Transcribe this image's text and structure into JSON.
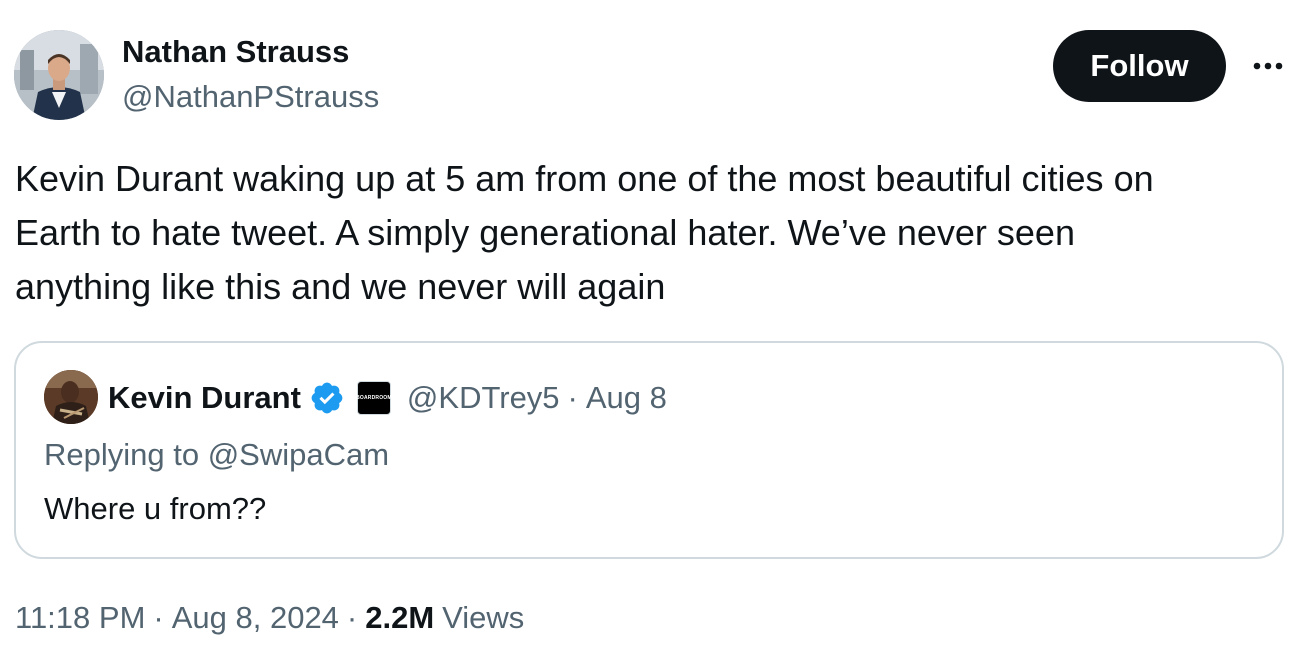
{
  "author": {
    "name": "Nathan Strauss",
    "handle": "@NathanPStrauss"
  },
  "actions": {
    "follow_label": "Follow",
    "more_icon": "more-horizontal-icon"
  },
  "tweet": {
    "lines": [
      "Kevin Durant waking up at 5 am from one of the most beautiful cities on",
      "Earth to hate tweet. A simply generational hater. We’ve never seen",
      "anything like this and we never will again"
    ]
  },
  "quoted": {
    "name": "Kevin Durant",
    "verified_icon": "verified-badge-icon",
    "affiliate_label": "BOARDROOM",
    "handle": "@KDTrey5",
    "separator": "·",
    "date": "Aug 8",
    "replying": "Replying to @SwipaCam",
    "body": "Where u from??"
  },
  "meta": {
    "time": "11:18 PM",
    "separator": "·",
    "date": "Aug 8, 2024",
    "views_count": "2.2M",
    "views_label": "Views"
  },
  "colors": {
    "text_primary": "#0f1419",
    "text_secondary": "#536471",
    "border": "#cfd9de",
    "verified_blue": "#1d9bf0",
    "follow_bg": "#0f1419"
  }
}
